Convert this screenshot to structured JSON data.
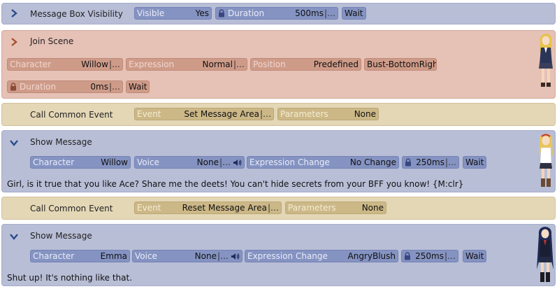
{
  "commands": [
    {
      "title": "Message Box Visibility",
      "fields": {
        "visible_label": "Visible",
        "visible_value": "Yes",
        "duration_label": "Duration",
        "duration_value": "500ms",
        "wait": "Wait"
      }
    },
    {
      "title": "Join Scene",
      "fields": {
        "character_label": "Character",
        "character_value": "Willow",
        "expression_label": "Expression",
        "expression_value": "Normal",
        "position_label": "Position",
        "position_value": "Predefined",
        "position_preset": "Bust-BottomRight",
        "duration_label": "Duration",
        "duration_value": "0ms",
        "wait": "Wait"
      }
    },
    {
      "title": "Call Common Event",
      "fields": {
        "event_label": "Event",
        "event_value": "Set Message Area",
        "params_label": "Parameters",
        "params_value": "None"
      }
    },
    {
      "title": "Show Message",
      "fields": {
        "character_label": "Character",
        "character_value": "Willow",
        "voice_label": "Voice",
        "voice_value": "None",
        "exprchange_label": "Expression Change",
        "exprchange_value": "No Change",
        "duration_value": "250ms",
        "wait": "Wait"
      },
      "message": "Girl, is it true that you like Ace? Share me the deets! You can't hide secrets from your BFF you know! {M:clr}"
    },
    {
      "title": "Call Common Event",
      "fields": {
        "event_label": "Event",
        "event_value": "Reset Message Area",
        "params_label": "Parameters",
        "params_value": "None"
      }
    },
    {
      "title": "Show Message",
      "fields": {
        "character_label": "Character",
        "character_value": "Emma",
        "voice_label": "Voice",
        "voice_value": "None",
        "exprchange_label": "Expression Change",
        "exprchange_value": "AngryBlush",
        "duration_value": "250ms",
        "wait": "Wait"
      },
      "message": "Shut up! It's nothing like that."
    }
  ],
  "ellipsis": "|…",
  "icons": {
    "collapsed": "chevron-right-icon",
    "expanded": "chevron-down-icon",
    "lock": "lock-icon",
    "speaker": "speaker-icon"
  },
  "colors": {
    "blue_card": "#b8bed6",
    "pink_card": "#e6c1b6",
    "tan_card": "#e4d7b6",
    "chevron_blue": "#2d4a8a",
    "chevron_orange": "#a5522e"
  }
}
